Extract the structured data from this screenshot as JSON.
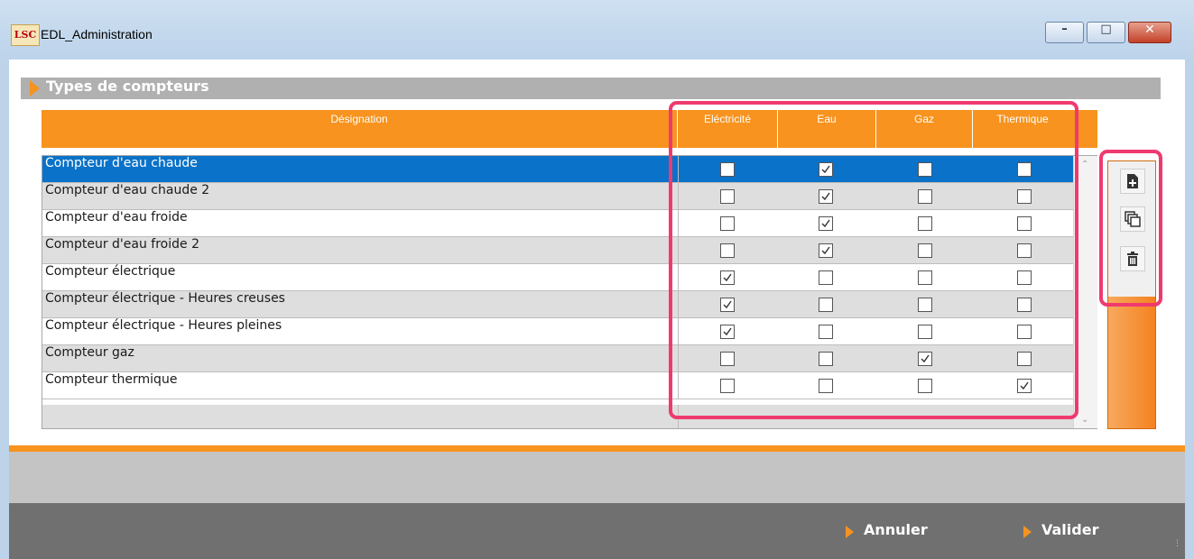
{
  "window": {
    "logo_text": "LSC",
    "title": "EDL_Administration",
    "minimize": "–",
    "maximize": "□",
    "close": "✕"
  },
  "section": {
    "title": "Types de compteurs"
  },
  "table": {
    "columns": [
      "Désignation",
      "Eléctricité",
      "Eau",
      "Gaz",
      "Thermique"
    ],
    "rows": [
      {
        "name": "Compteur d'eau chaude",
        "electricite": false,
        "eau": true,
        "gaz": false,
        "thermique": false,
        "selected": true
      },
      {
        "name": "Compteur d'eau chaude 2",
        "electricite": false,
        "eau": true,
        "gaz": false,
        "thermique": false,
        "selected": false
      },
      {
        "name": "Compteur d'eau froide",
        "electricite": false,
        "eau": true,
        "gaz": false,
        "thermique": false,
        "selected": false
      },
      {
        "name": "Compteur d'eau froide 2",
        "electricite": false,
        "eau": true,
        "gaz": false,
        "thermique": false,
        "selected": false
      },
      {
        "name": "Compteur électrique",
        "electricite": true,
        "eau": false,
        "gaz": false,
        "thermique": false,
        "selected": false
      },
      {
        "name": "Compteur électrique - Heures creuses",
        "electricite": true,
        "eau": false,
        "gaz": false,
        "thermique": false,
        "selected": false
      },
      {
        "name": "Compteur électrique - Heures pleines",
        "electricite": true,
        "eau": false,
        "gaz": false,
        "thermique": false,
        "selected": false
      },
      {
        "name": "Compteur gaz",
        "electricite": false,
        "eau": false,
        "gaz": true,
        "thermique": false,
        "selected": false
      },
      {
        "name": "Compteur thermique",
        "electricite": false,
        "eau": false,
        "gaz": false,
        "thermique": true,
        "selected": false
      }
    ]
  },
  "tools": [
    {
      "icon": "add-document-icon"
    },
    {
      "icon": "duplicate-icon"
    },
    {
      "icon": "trash-icon"
    }
  ],
  "footer": {
    "cancel_label": "Annuler",
    "validate_label": "Valider"
  },
  "colors": {
    "accent": "#f7931e",
    "selected_row": "#0a72c8",
    "highlight": "#ef3a6f"
  }
}
